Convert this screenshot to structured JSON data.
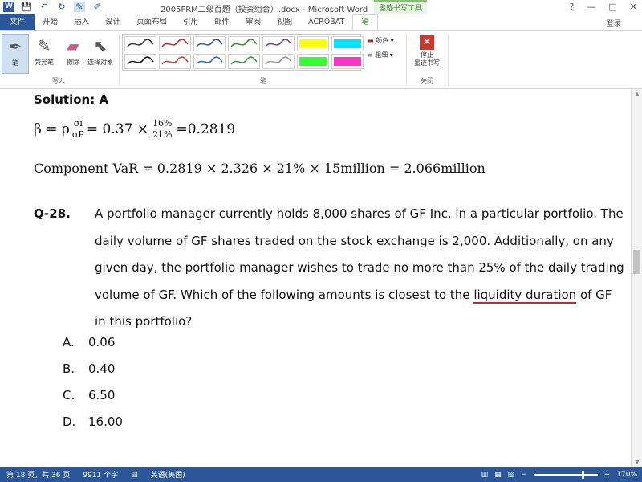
{
  "window": {
    "title": "2005FRM二级百题（投资组合）.docx - Microsoft Word",
    "context_tab": "墨迹书写工具",
    "login": "登录",
    "help": "?",
    "controls": [
      "?",
      "—",
      "□",
      "✕"
    ]
  },
  "quick_access": [
    "W",
    "💾",
    "↶",
    "↻",
    "✎",
    "✐"
  ],
  "tabs": [
    "文件",
    "开始",
    "插入",
    "设计",
    "页面布局",
    "引用",
    "邮件",
    "审阅",
    "视图",
    "ACROBAT",
    "笔"
  ],
  "ribbon": {
    "write_group": {
      "label": "写入",
      "buttons": [
        {
          "label": "笔",
          "icon": "pen-icon"
        },
        {
          "label": "荧光笔",
          "icon": "highlighter-icon"
        },
        {
          "label": "擦除",
          "icon": "eraser-icon"
        },
        {
          "label": "选择对象",
          "icon": "pointer-icon"
        }
      ]
    },
    "pens_group": {
      "label": "笔",
      "pen_colors": [
        "#333333",
        "#c9252c",
        "#2b579a",
        "#3a8a2f",
        "#7a3a9a",
        "#ffff00",
        "#00e5ff",
        "#111111",
        "#d0362d",
        "#1f6fc0",
        "#2e9b3f",
        "#9a9a9a",
        "#33ff33",
        "#ff33cc"
      ],
      "color_label": "颜色",
      "thickness_label": "粗细"
    },
    "close_group": {
      "label": "关闭",
      "stop_label": "停止\n墨迹书写"
    }
  },
  "document": {
    "solution": "Solution: A",
    "beta_formula": {
      "lhs": "β = ρ",
      "frac1_num": "σi",
      "frac1_den": "σP",
      "mid": "= 0.37 ×",
      "frac2_num": "16%",
      "frac2_den": "21%",
      "result": "=0.2819"
    },
    "var_formula": "Component VaR = 0.2819 × 2.326 × 21% × 15million = 2.066million",
    "question": {
      "number": "Q-28.",
      "text_before": "A portfolio manager currently holds 8,000 shares of GF Inc. in a particular portfolio. The daily volume of GF shares traded on the stock exchange is 2,000. Additionally, on any given day, the portfolio manager wishes to trade no more than 25% of the daily trading volume of GF. Which of the following amounts is closest to the ",
      "underlined": "liquidity duration",
      "text_after": " of GF in this portfolio?"
    },
    "options": [
      {
        "label": "A.",
        "value": "0.06"
      },
      {
        "label": "B.",
        "value": "0.40"
      },
      {
        "label": "C.",
        "value": "6.50"
      },
      {
        "label": "D.",
        "value": "16.00"
      }
    ]
  },
  "status": {
    "page": "第 18 页，共 36 页",
    "words": "9911 个字",
    "language": "英语(美国)",
    "zoom": "170%",
    "zoom_minus": "−",
    "zoom_plus": "+"
  }
}
